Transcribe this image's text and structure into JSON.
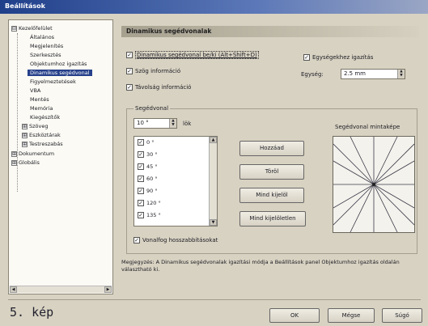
{
  "window": {
    "title": "Beállítások"
  },
  "tree": {
    "items": [
      {
        "label": "Kezelőfelület",
        "expander": "⊟"
      },
      {
        "label": "Általános"
      },
      {
        "label": "Megjelenítés"
      },
      {
        "label": "Szerkesztés"
      },
      {
        "label": "Objektumhoz igazítás"
      },
      {
        "label": "Dinamikus segédvonal"
      },
      {
        "label": "Figyelmeztetések"
      },
      {
        "label": "VBA"
      },
      {
        "label": "Mentés"
      },
      {
        "label": "Memória"
      },
      {
        "label": "Kiegészítők"
      },
      {
        "label": "Szöveg",
        "expander": "⊞"
      },
      {
        "label": "Eszköztárak",
        "expander": "⊞"
      },
      {
        "label": "Testreszabás",
        "expander": "⊞"
      },
      {
        "label": "Dokumentum",
        "expander": "⊞"
      },
      {
        "label": "Globális",
        "expander": "⊞"
      }
    ]
  },
  "panel": {
    "header": "Dinamikus segédvonalak",
    "enable_label": "Dinamikus segédvonal be/ki (Alt+Shift+D)",
    "snap_grid_label": "Egységekhez igazítás",
    "angle_info_label": "Szög információ",
    "distance_info_label": "Távolság információ",
    "unit_label": "Egység:",
    "unit_value": "2.5 mm",
    "group_label": "Segédvonal",
    "step_value": "10 °",
    "step_suffix": "lök",
    "angles": [
      "0 °",
      "30 °",
      "45 °",
      "60 °",
      "90 °",
      "120 °",
      "135 °"
    ],
    "buttons": {
      "add": "Hozzáad",
      "delete": "Töröl",
      "select_all": "Mind kijelöl",
      "deselect_all": "Mind kijelöletlen"
    },
    "preview_label": "Segédvonal mintaképe",
    "extension_label": "Vonalfog hosszabbításokat",
    "note": "Megjegyzés: A Dinamikus segédvonalak igazítási módja a Beállítások panel Objektumhoz igazítás oldalán választható ki."
  },
  "footer": {
    "caption": "5. kép",
    "ok": "OK",
    "cancel": "Mégse",
    "help": "Súgó"
  },
  "colors": {
    "selection": "#26408a",
    "titlebar": "#1f3f8a"
  }
}
